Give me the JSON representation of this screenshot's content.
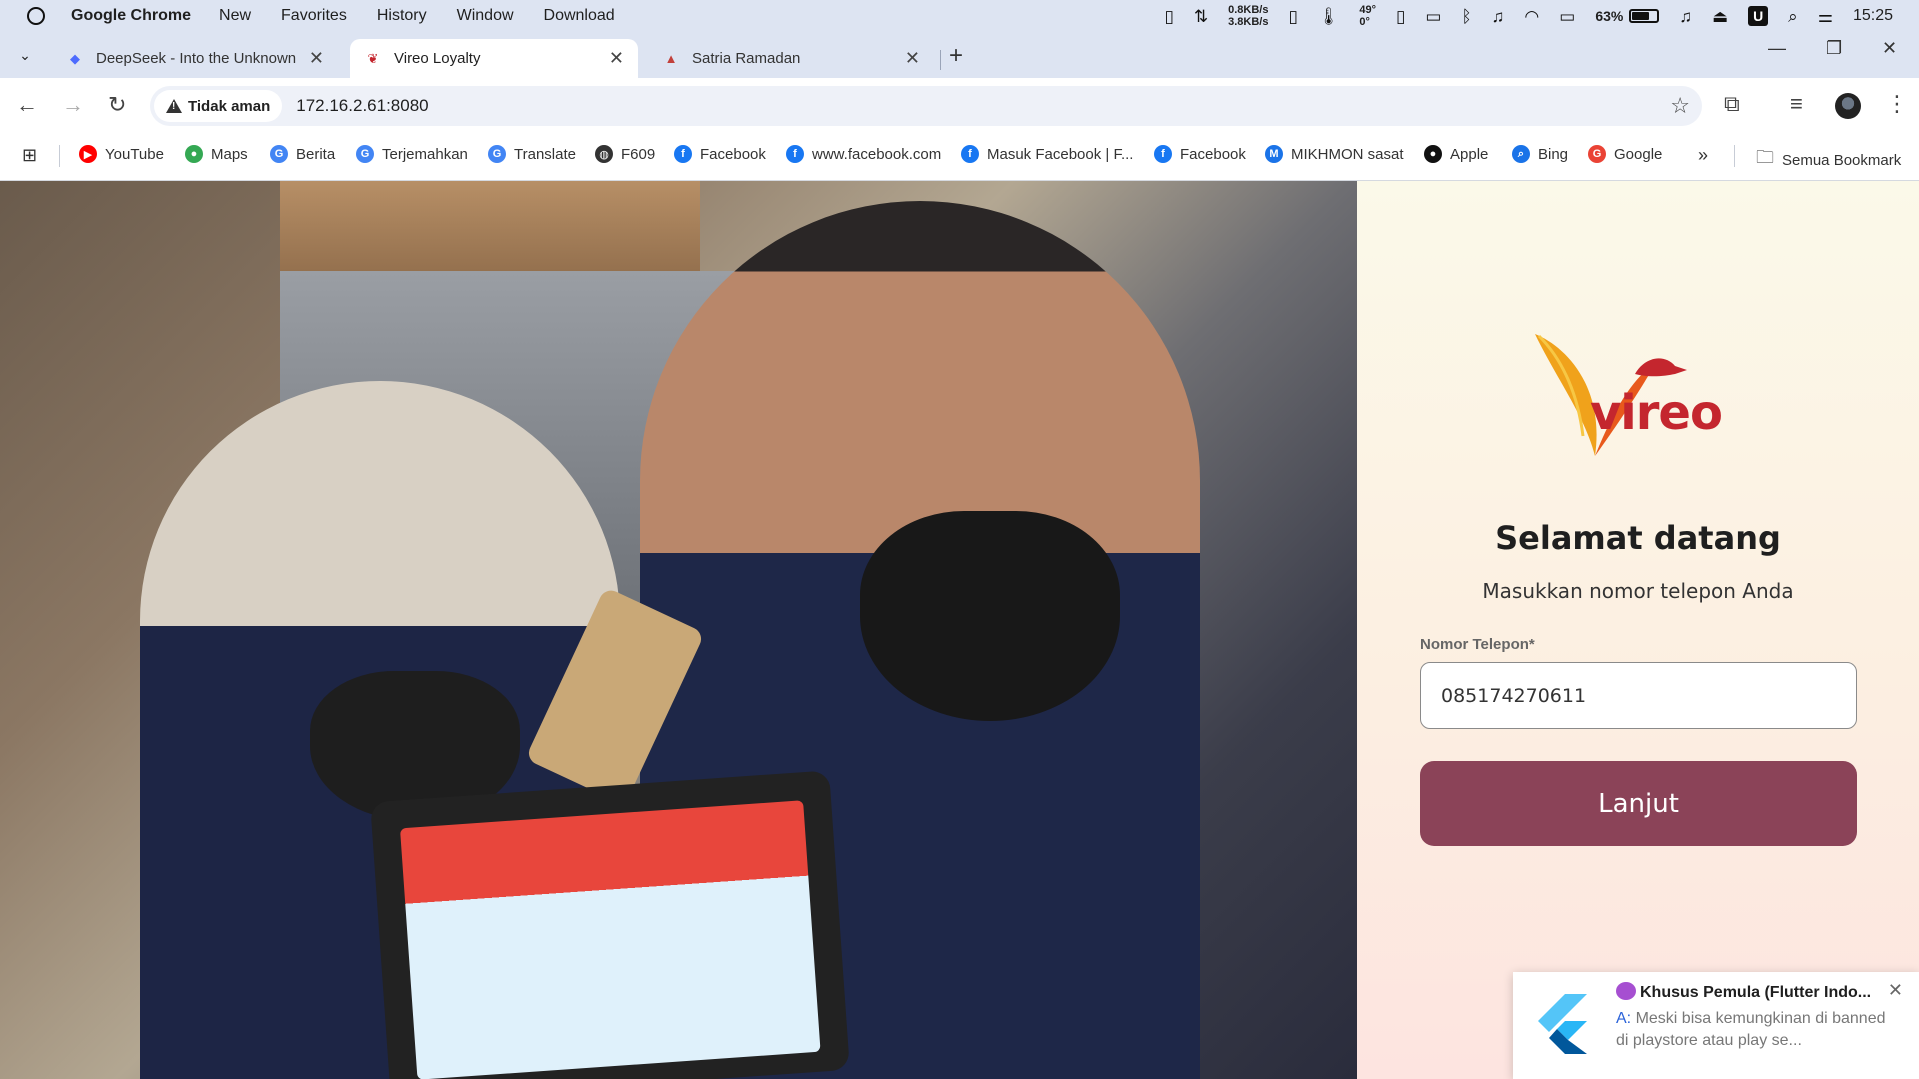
{
  "menubar": {
    "app_name": "Google Chrome",
    "items": [
      "New",
      "Favorites",
      "History",
      "Window",
      "Download"
    ],
    "net_up": "0.8KB/s",
    "net_down": "3.8KB/s",
    "temp_top": "49°",
    "temp_bottom": "0°",
    "battery_percent": "63%",
    "battery_level": 0.63,
    "time": "15:25"
  },
  "tabs": [
    {
      "title": "DeepSeek - Into the Unknown",
      "active": false,
      "favicon": "deepseek-icon",
      "color": "#4d6bfe"
    },
    {
      "title": "Vireo Loyalty",
      "active": true,
      "favicon": "vireo-icon",
      "color": "#c4262e"
    },
    {
      "title": "Satria Ramadan",
      "active": false,
      "favicon": "satria-icon",
      "color": "#c2403b"
    }
  ],
  "toolbar": {
    "security_label": "Tidak aman",
    "url": "172.16.2.61:8080"
  },
  "bookmarks": [
    {
      "label": "YouTube",
      "icon": "youtube-icon",
      "color": "#ff0000"
    },
    {
      "label": "Maps",
      "icon": "maps-icon",
      "color": "#34a853"
    },
    {
      "label": "Berita",
      "icon": "news-icon",
      "color": "#4285f4"
    },
    {
      "label": "Terjemahkan",
      "icon": "translate-icon",
      "color": "#4285f4"
    },
    {
      "label": "Translate",
      "icon": "translate-icon",
      "color": "#4285f4"
    },
    {
      "label": "F609",
      "icon": "globe-icon",
      "color": "#333333"
    },
    {
      "label": "Facebook",
      "icon": "facebook-icon",
      "color": "#1877f2"
    },
    {
      "label": "www.facebook.com",
      "icon": "facebook-icon",
      "color": "#1877f2"
    },
    {
      "label": "Masuk Facebook | F...",
      "icon": "facebook-icon",
      "color": "#1877f2"
    },
    {
      "label": "Facebook",
      "icon": "facebook-icon",
      "color": "#1877f2"
    },
    {
      "label": "MIKHMON sasat",
      "icon": "mikhmon-icon",
      "color": "#1a73e8"
    },
    {
      "label": "Apple",
      "icon": "apple-icon",
      "color": "#111111"
    },
    {
      "label": "Bing",
      "icon": "search-icon",
      "color": "#1a73e8"
    },
    {
      "label": "Google",
      "icon": "google-icon",
      "color": "#ea4335"
    }
  ],
  "bookmarks_more": "»",
  "all_bookmarks": "Semua Bookmark",
  "login": {
    "brand": "vireo",
    "title": "Selamat datang",
    "subtitle": "Masukkan nomor telepon Anda",
    "field_label": "Nomor Telepon*",
    "phone_value": "085174270611",
    "button_label": "Lanjut",
    "accent_color": "#8b4358"
  },
  "notification": {
    "title": "Khusus Pemula (Flutter Indo...",
    "sender": "A:",
    "body": " Meski bisa kemungkinan di banned di playstore atau play se..."
  }
}
